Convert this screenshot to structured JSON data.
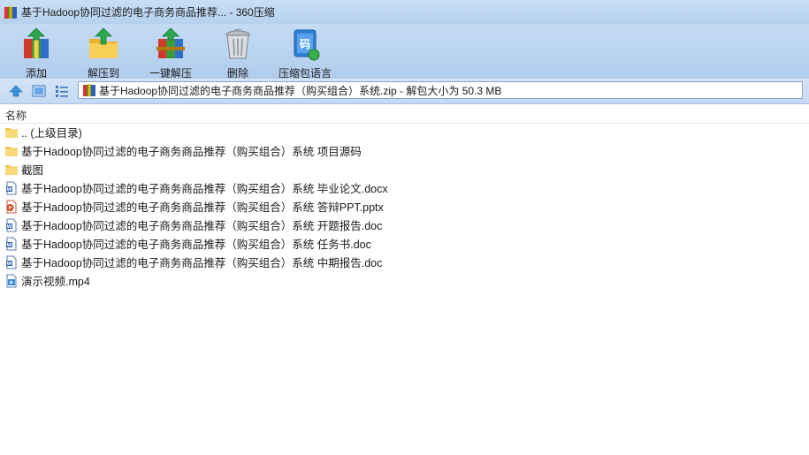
{
  "window": {
    "title": "基于Hadoop协同过滤的电子商务商品推荐... - 360压缩"
  },
  "toolbar": {
    "add_label": "添加",
    "extract_to_label": "解压到",
    "one_click_extract_label": "一键解压",
    "delete_label": "删除",
    "encoding_label": "压缩包语言"
  },
  "address": {
    "path": "基于Hadoop协同过滤的电子商务商品推荐（购买组合）系统.zip - 解包大小为 50.3 MB"
  },
  "columns": {
    "name": "名称"
  },
  "files": [
    {
      "name": ".. (上级目录)",
      "type": "folder"
    },
    {
      "name": "基于Hadoop协同过滤的电子商务商品推荐（购买组合）系统 项目源码",
      "type": "folder"
    },
    {
      "name": "截图",
      "type": "folder"
    },
    {
      "name": "基于Hadoop协同过滤的电子商务商品推荐（购买组合）系统 毕业论文.docx",
      "type": "word"
    },
    {
      "name": "基于Hadoop协同过滤的电子商务商品推荐（购买组合）系统 答辩PPT.pptx",
      "type": "ppt"
    },
    {
      "name": "基于Hadoop协同过滤的电子商务商品推荐（购买组合）系统 开题报告.doc",
      "type": "word"
    },
    {
      "name": "基于Hadoop协同过滤的电子商务商品推荐（购买组合）系统 任务书.doc",
      "type": "word"
    },
    {
      "name": "基于Hadoop协同过滤的电子商务商品推荐（购买组合）系统 中期报告.doc",
      "type": "word"
    },
    {
      "name": "演示视频.mp4",
      "type": "video"
    }
  ]
}
